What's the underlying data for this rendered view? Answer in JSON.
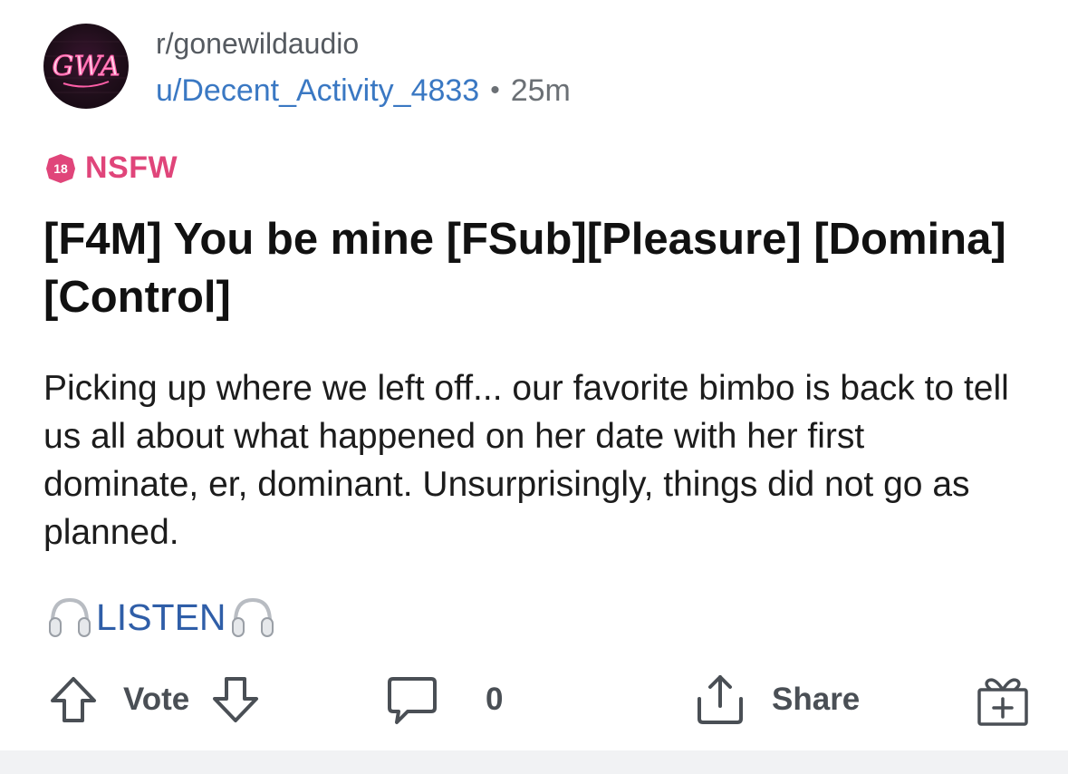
{
  "post": {
    "subreddit": "r/gonewildaudio",
    "avatar_text": "GWA",
    "username": "u/Decent_Activity_4833",
    "separator": "•",
    "time": "25m",
    "nsfw_badge_number": "18",
    "nsfw_label": "NSFW",
    "title": "[F4M] You be mine [FSub][Pleasure] [Domina][Control]",
    "body": "Picking up where we left off... our favorite bimbo is back to tell us all about what happened on her date with her first dominate, er, dominant. Unsurprisingly, things did not go as planned.",
    "listen_label": "LISTEN"
  },
  "actions": {
    "vote_label": "Vote",
    "comment_count": "0",
    "share_label": "Share"
  },
  "icons": {
    "upvote": "arrow-up-icon",
    "downvote": "arrow-down-icon",
    "comment": "comment-bubble-icon",
    "share": "share-icon",
    "award": "gift-icon",
    "headphones": "headphones-icon",
    "nsfw": "nsfw-18-icon"
  },
  "colors": {
    "username": "#3a78c3",
    "nsfw": "#e0457a",
    "listen": "#2f5ea8",
    "action_gray": "#4a4f55",
    "avatar_neon": "#ff5fa8"
  }
}
